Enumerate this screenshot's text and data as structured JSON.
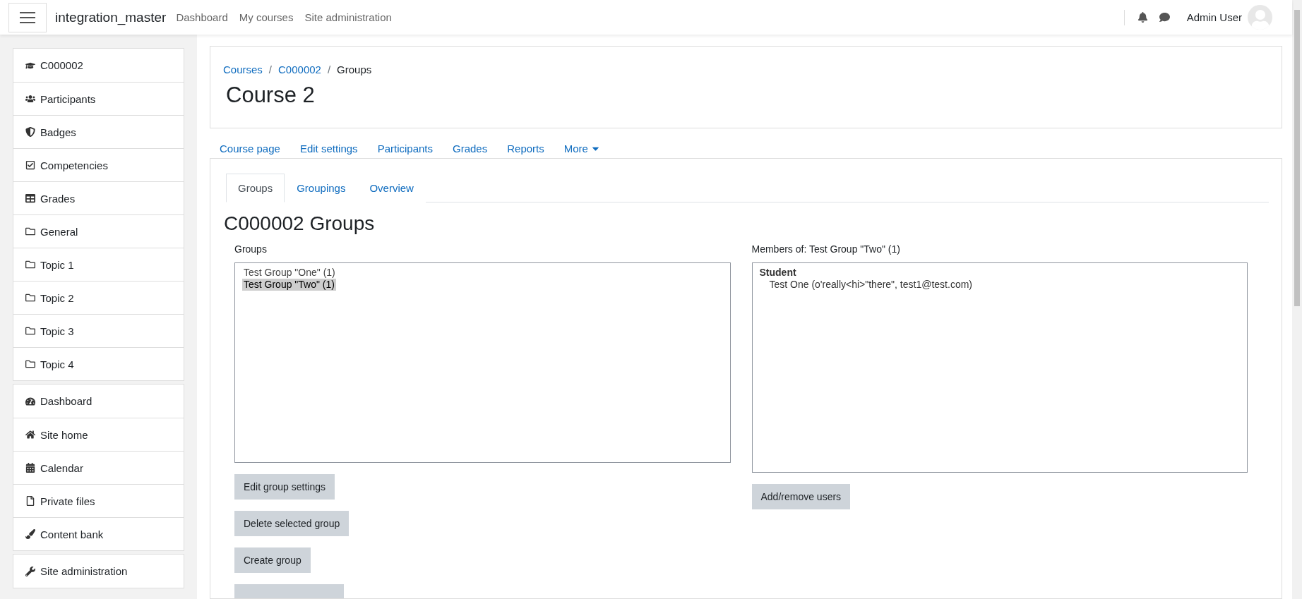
{
  "navbar": {
    "site_name": "integration_master",
    "links": [
      "Dashboard",
      "My courses",
      "Site administration"
    ],
    "user_name": "Admin User"
  },
  "sidebar": {
    "sections": [
      {
        "items": [
          "C000002",
          "Participants",
          "Badges",
          "Competencies",
          "Grades",
          "General",
          "Topic 1",
          "Topic 2",
          "Topic 3",
          "Topic 4"
        ]
      },
      {
        "items": [
          "Dashboard",
          "Site home",
          "Calendar",
          "Private files",
          "Content bank"
        ]
      },
      {
        "items": [
          "Site administration"
        ]
      }
    ]
  },
  "breadcrumb": [
    "Courses",
    "C000002",
    "Groups"
  ],
  "breadcrumb_separator": "/",
  "course_title": "Course 2",
  "course_nav": [
    "Course page",
    "Edit settings",
    "Participants",
    "Grades",
    "Reports",
    "More"
  ],
  "tabs": [
    {
      "label": "Groups",
      "selected": true
    },
    {
      "label": "Groupings",
      "selected": false
    },
    {
      "label": "Overview",
      "selected": false
    }
  ],
  "heading": "C000002 Groups",
  "groups": {
    "label": "Groups",
    "items": [
      {
        "label": "Test Group \"One\" (1)",
        "selected": false
      },
      {
        "label": "Test Group \"Two\" (1)",
        "selected": true
      }
    ],
    "buttons": [
      "Edit group settings",
      "Delete selected group",
      "Create group"
    ]
  },
  "members": {
    "label": "Members of: Test Group \"Two\" (1)",
    "roles": [
      {
        "role": "Student",
        "members": [
          "Test One (o'really<hi>\"there\", test1@test.com)"
        ]
      }
    ],
    "buttons": [
      "Add/remove users"
    ]
  }
}
